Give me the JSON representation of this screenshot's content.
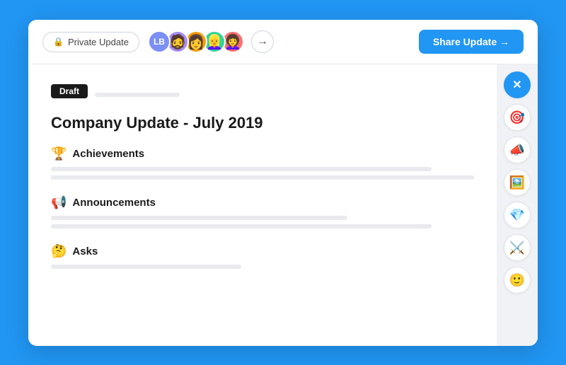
{
  "toolbar": {
    "private_update_label": "Private Update",
    "share_button_label": "Share Update →",
    "arrow_label": "→"
  },
  "avatars": [
    {
      "type": "initials",
      "text": "LB",
      "color": "#7b8ff5"
    },
    {
      "type": "emoji",
      "text": "👨",
      "color": "#c8a882"
    },
    {
      "type": "emoji",
      "text": "👩",
      "color": "#b07b5a"
    },
    {
      "type": "emoji",
      "text": "👱‍♀️",
      "color": "#e8b87a"
    },
    {
      "type": "emoji",
      "text": "👩‍🦱",
      "color": "#d4956a"
    }
  ],
  "document": {
    "draft_label": "Draft",
    "title": "Company Update - July 2019",
    "sections": [
      {
        "emoji": "🏆",
        "label": "Achievements"
      },
      {
        "emoji": "📢",
        "label": "Announcements"
      },
      {
        "emoji": "🤔",
        "label": "Asks"
      }
    ]
  },
  "sidebar_tools": [
    {
      "name": "close",
      "emoji": "✕",
      "is_close": true
    },
    {
      "name": "target",
      "emoji": "🎯"
    },
    {
      "name": "megaphone",
      "emoji": "📣"
    },
    {
      "name": "image",
      "emoji": "🖼️"
    },
    {
      "name": "diamond",
      "emoji": "💎"
    },
    {
      "name": "tools",
      "emoji": "⚔️"
    },
    {
      "name": "face",
      "emoji": "🙂"
    }
  ]
}
